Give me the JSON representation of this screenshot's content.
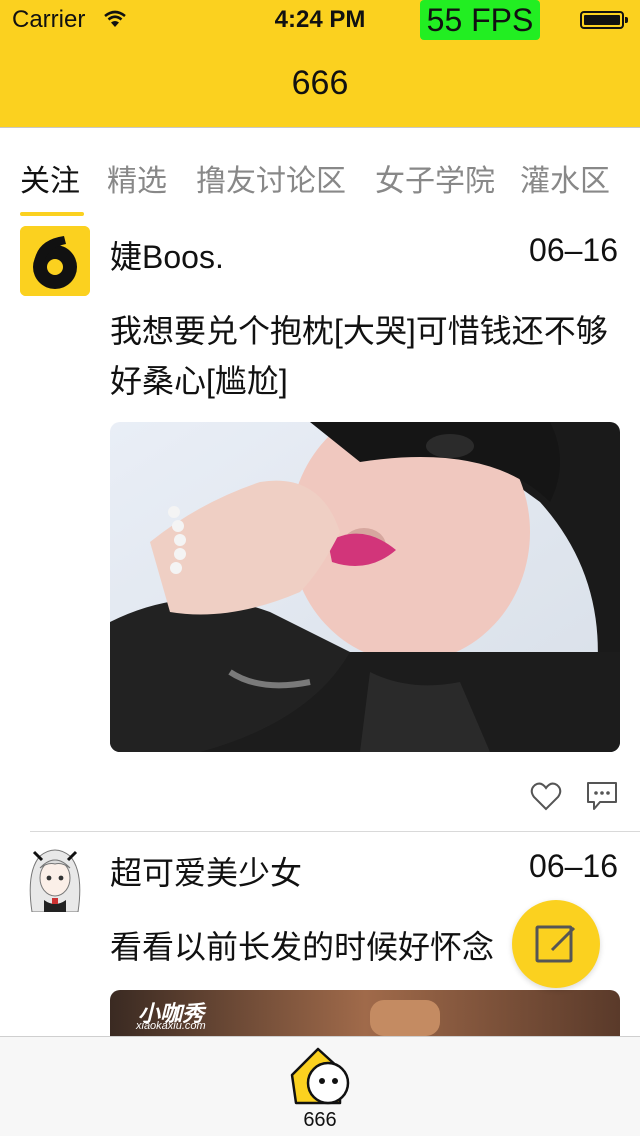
{
  "status_bar": {
    "carrier": "Carrier",
    "time": "4:24 PM",
    "fps": "55 FPS"
  },
  "nav": {
    "title": "666"
  },
  "tabs": [
    {
      "label": "关注",
      "active": true
    },
    {
      "label": "精选"
    },
    {
      "label": "撸友讨论区"
    },
    {
      "label": "女子学院"
    },
    {
      "label": "灌水区"
    }
  ],
  "posts": [
    {
      "author": "婕Boos.",
      "date": "06–16",
      "text": "我想要兑个抱枕[大哭]可惜钱还不够好桑心[尴尬]",
      "avatar_icon": "six-logo-icon",
      "image_icon": "photo-of-woman"
    },
    {
      "author": "超可爱美少女",
      "date": "06–16",
      "text": "看看以前长发的时候好怀念",
      "avatar_icon": "anime-girl-avatar",
      "image_watermark": "小咖秀",
      "image_watermark_url": "xiaokaxiu.com"
    }
  ],
  "icons": {
    "like": "heart-icon",
    "comment": "comment-icon",
    "compose": "compose-icon",
    "home": "home-face-icon"
  },
  "tab_bar": {
    "items": [
      {
        "label": "666"
      }
    ]
  },
  "colors": {
    "accent": "#fbd11f",
    "fps_bg": "#22ee22"
  }
}
